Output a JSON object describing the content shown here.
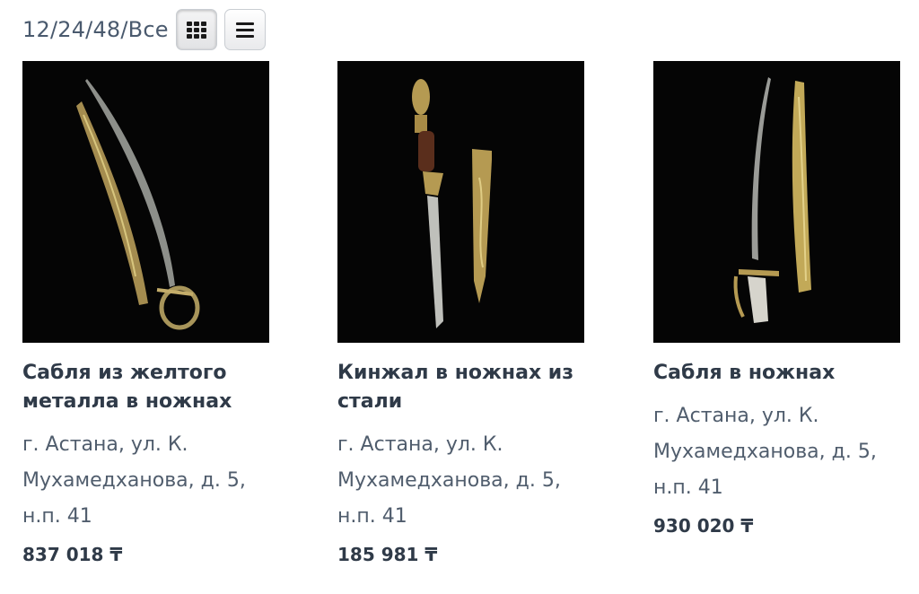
{
  "toolbar": {
    "per_page": "12/24/48/Все",
    "grid_view_icon": "grid-icon",
    "list_view_icon": "list-icon"
  },
  "products": [
    {
      "title_line1": "Сабля из желтого",
      "title_line2": "металла в ножнах",
      "address_line1": "г. Астана, ул. К.",
      "address_line2": "Мухамедханова, д. 5,",
      "address_line3": "н.п. 41",
      "price": "837 018 ₸"
    },
    {
      "title_line1": "Кинжал в ножнах из",
      "title_line2": "стали",
      "address_line1": "г. Астана, ул. К.",
      "address_line2": "Мухамедханова, д. 5,",
      "address_line3": "н.п. 41",
      "price": "185 981 ₸"
    },
    {
      "title_line1": "Сабля в ножнах",
      "title_line2": "",
      "address_line1": "г. Астана, ул. К.",
      "address_line2": "Мухамедханова, д. 5,",
      "address_line3": "н.п. 41",
      "price": "930 020 ₸"
    }
  ],
  "colors": {
    "photo_background": "#050505",
    "heading": "#2f3a48",
    "body_text": "#505d6d",
    "brass": "#b79a4e"
  }
}
